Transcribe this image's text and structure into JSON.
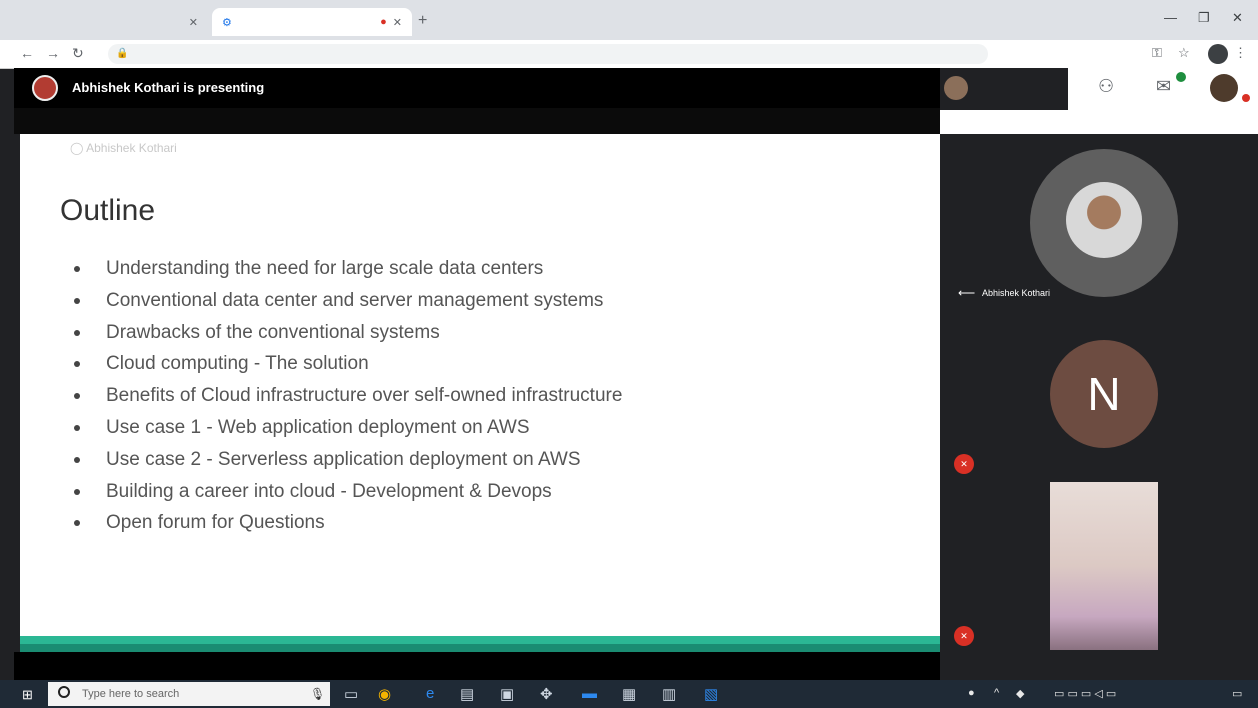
{
  "browser": {
    "tab_inactive": "",
    "tab_active": "",
    "url": ""
  },
  "meet": {
    "presenting_label": "Abhishek Kothari is presenting",
    "people_count": "",
    "slide": {
      "header_left": "Abhishek Kothari",
      "header_center": "",
      "header_right": "",
      "title": "Outline",
      "items": [
        "Understanding the need for large scale data centers",
        "Conventional data center and server management systems",
        "Drawbacks of the conventional systems",
        "Cloud computing - The solution",
        "Benefits of Cloud infrastructure over self-owned infrastructure",
        "Use case 1 - Web application deployment on AWS",
        "Use case 2 - Serverless application deployment on AWS",
        "Building a career into cloud - Development & Devops",
        "Open forum for Questions"
      ]
    },
    "participants": [
      {
        "name": "Abhishek Kothari"
      },
      {
        "name": "",
        "initial": "N"
      },
      {
        "name": ""
      }
    ]
  },
  "taskbar": {
    "search_placeholder": "Type here to search",
    "time": "",
    "date": ""
  },
  "colors": {
    "slide_accent": "#2bb794",
    "mic_off": "#d93025",
    "n_avatar": "#6d4c41"
  },
  "icons": [
    "search-icon",
    "lock-icon",
    "pin-icon",
    "mic-off-icon",
    "windows-start-icon",
    "mic-icon",
    "chat-icon",
    "people-icon"
  ]
}
